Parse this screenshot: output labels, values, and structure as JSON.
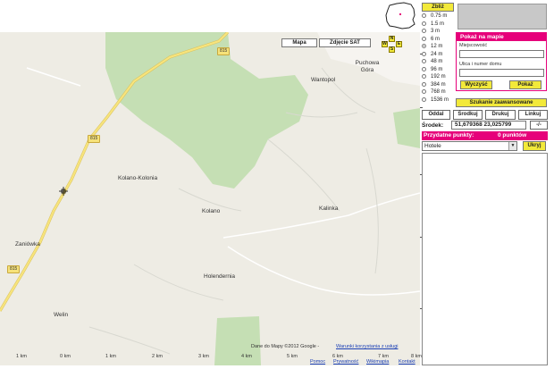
{
  "map": {
    "type_buttons": {
      "map": "Mapa",
      "sat": "Zdjęcie SAT"
    },
    "compass": {
      "north": "N",
      "west": "W",
      "east": "E",
      "south": "S"
    },
    "road_badges": [
      "815",
      "815",
      "815"
    ],
    "places": [
      "Puchowa Góra",
      "Wantopol",
      "Kolano-Kolonia",
      "Kolano",
      "Kalinka",
      "Zaniówka",
      "Holendernia",
      "Welin"
    ],
    "attribution_prefix": "Dane do Mapy ©2012 Google -",
    "attribution_link": "Warunki korzystania z usługi",
    "scale_labels": [
      "1 km",
      "0 km",
      "1 km",
      "2 km",
      "3 km",
      "4 km",
      "5 km",
      "6 km",
      "7 km",
      "8 km"
    ]
  },
  "footer": {
    "links": [
      "Pomoc",
      "Prywatność",
      "Wikimapia",
      "Kontakt"
    ]
  },
  "zoom": {
    "button": "Zbliż",
    "levels": [
      "0.75 m",
      "1.5 m",
      "3 m",
      "6 m",
      "12 m",
      "24 m",
      "48 m",
      "96 m",
      "192 m",
      "384 m",
      "768 m",
      "1536 m"
    ],
    "selected_index": 4
  },
  "search": {
    "header": "Pokaż na mapie",
    "city_label": "Miejscowość",
    "city_value": "",
    "street_label": "Ulica i numer domu",
    "street_value": "",
    "clear_button": "Wyczyść",
    "show_button": "Pokaż",
    "advanced_button": "Szukanie zaawansowane"
  },
  "map_controls": {
    "zoom_out": "Oddal",
    "center": "Środkuj",
    "print": "Drukuj",
    "links": "Linkuj"
  },
  "center": {
    "label": "Środek:",
    "value": "51,679368 23,025799",
    "sub_button": "-/-"
  },
  "points": {
    "header": "Przydatne punkty:",
    "count": "0 punktów",
    "category_selected": "Hotele",
    "hide_button": "Ukryj"
  },
  "colors": {
    "pink": "#e6007a",
    "yellow": "#f2e93a",
    "map_bg": "#eeece4",
    "forest": "#c5dfb4",
    "road": "#f7e47d"
  }
}
